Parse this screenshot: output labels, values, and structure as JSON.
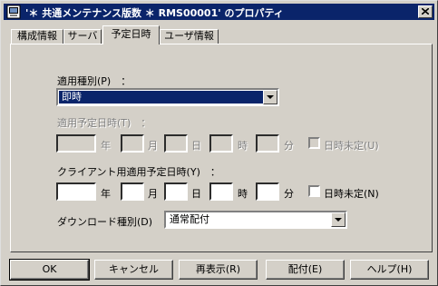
{
  "title": "'＊ 共通メンテナンス版数 ＊ RMS00001' のプロパティ",
  "tabs": [
    "構成情報",
    "サーバ",
    "予定日時",
    "ユーザ情報"
  ],
  "apply_type": {
    "label": "適用種別(P)　：",
    "value": "即時"
  },
  "scheduled": {
    "label": "適用予定日時(T)　：",
    "units": {
      "year": "年",
      "month": "月",
      "day": "日",
      "hour": "時",
      "minute": "分"
    },
    "undetermined": "日時未定(U)"
  },
  "client_scheduled": {
    "label": "クライアント用適用予定日時(Y)　：",
    "units": {
      "year": "年",
      "month": "月",
      "day": "日",
      "hour": "時",
      "minute": "分"
    },
    "undetermined": "日時未定(N)"
  },
  "download_type": {
    "label": "ダウンロード種別(D)　：",
    "value": "通常配付"
  },
  "buttons": {
    "ok": "OK",
    "cancel": "キャンセル",
    "redisplay": "再表示(R)",
    "distribute": "配付(E)",
    "help": "ヘルプ(H)"
  }
}
